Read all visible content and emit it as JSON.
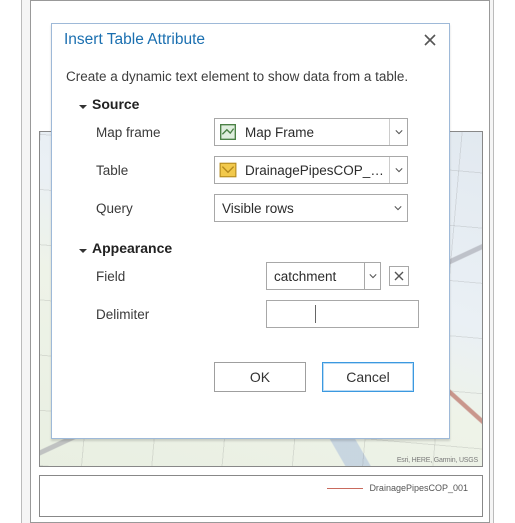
{
  "dialog": {
    "title": "Insert Table Attribute",
    "description": "Create a dynamic text element to show data from a table.",
    "sections": {
      "source": "Source",
      "appearance": "Appearance"
    },
    "labels": {
      "map_frame": "Map frame",
      "table": "Table",
      "query": "Query",
      "field": "Field",
      "delimiter": "Delimiter"
    },
    "values": {
      "map_frame": "Map Frame",
      "table": "DrainagePipesCOP_001",
      "query": "Visible rows",
      "field": "catchment",
      "delimiter": ""
    },
    "buttons": {
      "ok": "OK",
      "cancel": "Cancel"
    }
  },
  "layout": {
    "map_credits": "Esri, HERE, Garmin, USGS",
    "legend": {
      "item0": {
        "label": "DrainagePipesCOP_001",
        "color": "#c96a5d"
      }
    }
  }
}
